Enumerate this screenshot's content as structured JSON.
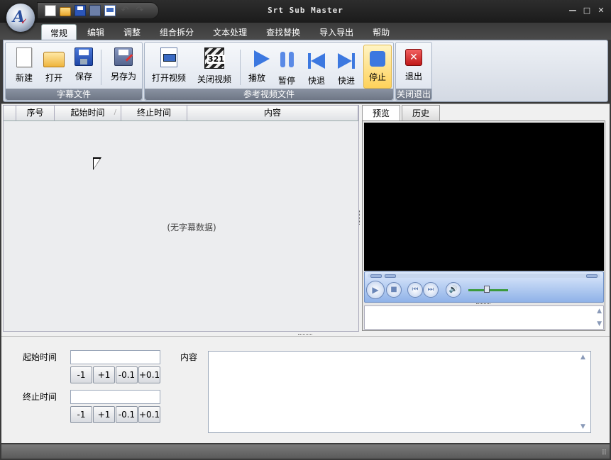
{
  "window": {
    "title": "Srt Sub Master"
  },
  "quick_access": [
    "new",
    "open",
    "save",
    "save-as",
    "document",
    "undo",
    "redo"
  ],
  "tabs": [
    "常规",
    "编辑",
    "调整",
    "组合拆分",
    "文本处理",
    "查找替换",
    "导入导出",
    "帮助"
  ],
  "ribbon": {
    "groups": [
      {
        "label": "字幕文件",
        "buttons": [
          "新建",
          "打开",
          "保存",
          "另存为"
        ]
      },
      {
        "label": "参考视频文件",
        "buttons": [
          "打开视频",
          "关闭视频",
          "播放",
          "暂停",
          "快退",
          "快进",
          "停止"
        ]
      },
      {
        "label": "关闭退出",
        "buttons": [
          "退出"
        ]
      }
    ]
  },
  "grid": {
    "columns": [
      "",
      "序号",
      "起始时间",
      "终止时间",
      "内容"
    ],
    "empty_text": "(无字幕数据)"
  },
  "preview": {
    "tabs": [
      "预览",
      "历史"
    ]
  },
  "editor": {
    "start_label": "起始时间",
    "end_label": "终止时间",
    "content_label": "内容",
    "start_value": "",
    "end_value": "",
    "content_value": "",
    "step_buttons": [
      "-1",
      "+1",
      "-0.1",
      "+0.1"
    ]
  },
  "colors": {
    "accent": "#3c78e0",
    "titlebar": "#1b1b1b",
    "ribbon_group_label": "#7a8292"
  }
}
